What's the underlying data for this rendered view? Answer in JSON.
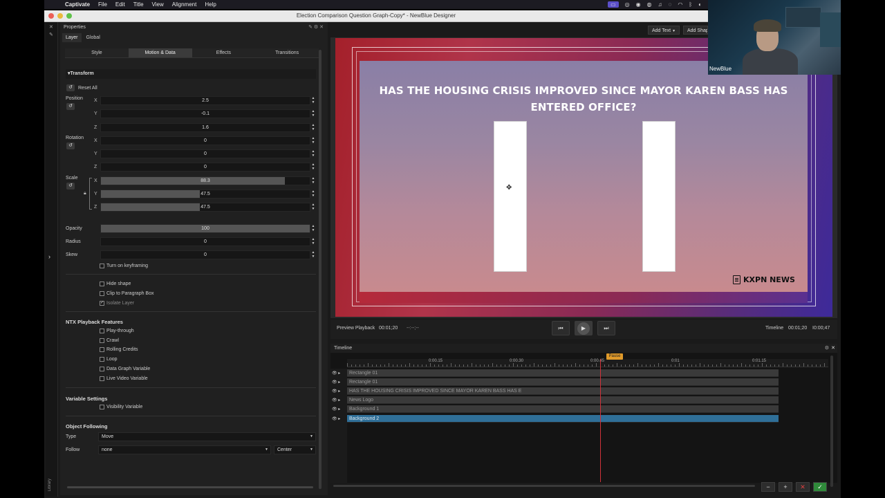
{
  "menubar": {
    "app": "Captivate",
    "items": [
      "File",
      "Edit",
      "Title",
      "View",
      "Alignment",
      "Help"
    ]
  },
  "window": {
    "title": "Election Comparison Question Graph-Copy* - NewBlue Designer"
  },
  "properties": {
    "title": "Properties",
    "top_tabs": [
      "Layer",
      "Global"
    ],
    "sub_tabs": [
      "Style",
      "Motion & Data",
      "Effects",
      "Transitions"
    ],
    "transform": {
      "header": "Transform",
      "reset_all": "Reset All",
      "position_label": "Position",
      "rotation_label": "Rotation",
      "scale_label": "Scale",
      "axes": [
        "X",
        "Y",
        "Z"
      ],
      "position": [
        "2.5",
        "-0.1",
        "1.6"
      ],
      "rotation": [
        "0",
        "0",
        "0"
      ],
      "scale": [
        "88.3",
        "47.5",
        "47.5"
      ],
      "scale_fill": [
        0.88,
        0.475,
        0.475
      ],
      "opacity_label": "Opacity",
      "opacity": "100",
      "opacity_fill": 1.0,
      "radius_label": "Radius",
      "radius": "0",
      "skew_label": "Skew",
      "skew": "0",
      "keyframing": "Turn on keyframing"
    },
    "options": {
      "hide_shape": "Hide shape",
      "clip": "Clip to Paragraph Box",
      "isolate": "Isolate Layer"
    },
    "ntx": {
      "header": "NTX Playback Features",
      "items": [
        "Play-through",
        "Crawl",
        "Rolling Credits",
        "Loop",
        "Data Graph Variable",
        "Live Video Variable"
      ]
    },
    "variables": {
      "header": "Variable Settings",
      "visibility": "Visibility Variable"
    },
    "following": {
      "header": "Object Following",
      "type_label": "Type",
      "type_value": "Move",
      "follow_label": "Follow",
      "follow_value": "none",
      "anchor_value": "Center"
    },
    "library": "Library"
  },
  "toolbar": {
    "add_text": "Add Text",
    "add_shape": "Add Shap"
  },
  "canvas": {
    "question": "HAS THE HOUSING CRISIS IMPROVED SINCE MAYOR KAREN BASS HAS ENTERED OFFICE?",
    "logo": "KXPN NEWS"
  },
  "playback": {
    "preview_label": "Preview Playback",
    "preview_time": "00:01;20",
    "preview_extra": "--:--;--",
    "timeline_label": "Timeline",
    "timeline_time": "00:01;20",
    "timeline_total": "I0:00;47"
  },
  "timeline": {
    "title": "Timeline",
    "ruler": [
      "0:00.15",
      "0:00.30",
      "0:00.45",
      "0:01",
      "0:01.15"
    ],
    "pause_tag": "Pause",
    "tracks": [
      "Rectangle 01",
      "Rectangle 01",
      "HAS THE HOUSING CRISIS IMPROVED SINCE MAYOR KAREN BASS HAS E",
      "News Logo",
      "Background 1",
      "Background 2"
    ]
  },
  "webcam": {
    "name": "NewBlue"
  }
}
